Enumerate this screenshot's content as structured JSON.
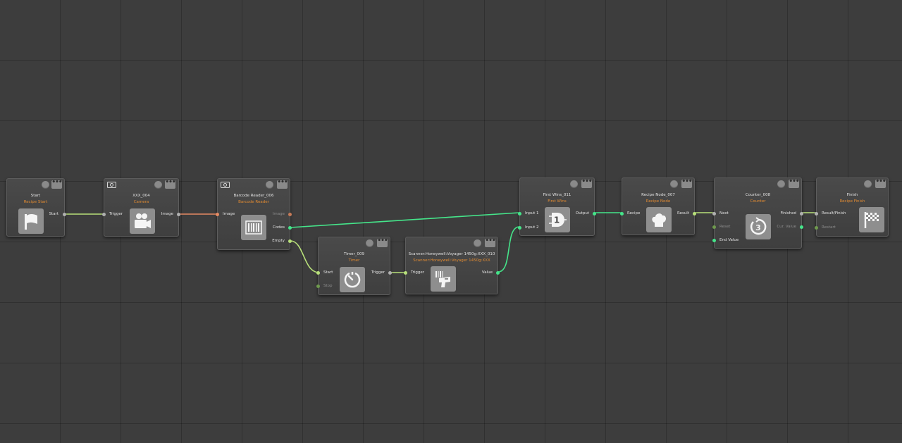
{
  "colors": {
    "background": "#3d3d3d",
    "subtitle": "#e08a32",
    "wire_exec": "#b8e07a",
    "wire_image": "#e58a63",
    "wire_data": "#45e58a"
  },
  "nodes": {
    "start": {
      "title": "Start",
      "subtitle": "Recipe Start",
      "icon": "flag-icon",
      "outputs": [
        "Start"
      ]
    },
    "camera": {
      "title": "XXX_004",
      "subtitle": "Camera",
      "icon": "video-camera-icon",
      "inputs": [
        "Trigger"
      ],
      "outputs": [
        "Image"
      ]
    },
    "barcode": {
      "title": "Barcode Reader_006",
      "subtitle": "Barcode Reader",
      "icon": "barcode-icon",
      "inputs": [
        "Image"
      ],
      "outputs": [
        "Image",
        "Codes",
        "Empty"
      ]
    },
    "timer": {
      "title": "Timer_009",
      "subtitle": "Timer",
      "icon": "timer-icon",
      "inputs": [
        "Start",
        "Stop"
      ],
      "outputs": [
        "Trigger"
      ]
    },
    "scanner": {
      "title": "Scanner:Honeywell:Voyager 1450g:XXX_010",
      "subtitle": "Scanner:Honeywell:Voyager 1450g:XXX",
      "icon": "barcode-scanner-icon",
      "inputs": [
        "Trigger"
      ],
      "outputs": [
        "Value"
      ]
    },
    "firstwins": {
      "title": "First Wins_011",
      "subtitle": "First Wins",
      "icon": "and-gate-icon",
      "icon_text": "1",
      "inputs": [
        "Input 1",
        "Input 2"
      ],
      "outputs": [
        "Output"
      ]
    },
    "recipe": {
      "title": "Recipe Node_007",
      "subtitle": "Recipe Node",
      "icon": "chef-hat-icon",
      "inputs": [
        "Recipe"
      ],
      "outputs": [
        "Result"
      ]
    },
    "counter": {
      "title": "Counter_008",
      "subtitle": "Counter",
      "icon": "counter-icon",
      "icon_text": "3",
      "inputs": [
        "Next",
        "Reset",
        "End Value"
      ],
      "outputs": [
        "Finished",
        "Cur. Value"
      ]
    },
    "finish": {
      "title": "Finish",
      "subtitle": "Recipe Finish",
      "icon": "checkered-flag-icon",
      "inputs": [
        "Result/Finish",
        "Restart"
      ]
    }
  }
}
